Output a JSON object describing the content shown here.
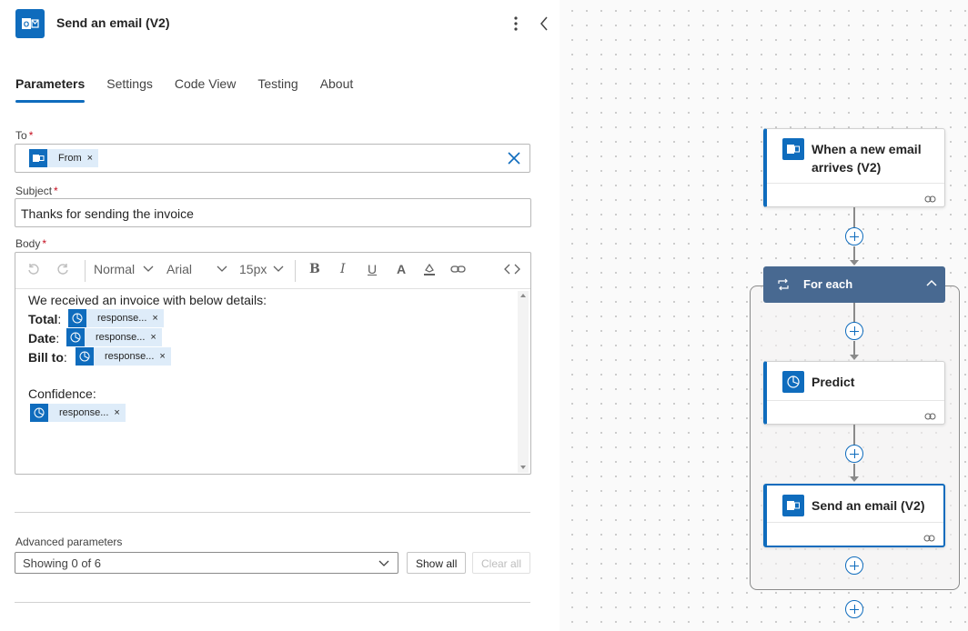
{
  "panel": {
    "title": "Send an email (V2)",
    "icon": "outlook-icon",
    "tabs": [
      {
        "label": "Parameters",
        "active": true
      },
      {
        "label": "Settings",
        "active": false
      },
      {
        "label": "Code View",
        "active": false
      },
      {
        "label": "Testing",
        "active": false
      },
      {
        "label": "About",
        "active": false
      }
    ],
    "to": {
      "label": "To",
      "required": "*",
      "token": "From"
    },
    "subject": {
      "label": "Subject",
      "required": "*",
      "value": "Thanks for sending the invoice"
    },
    "body": {
      "label": "Body",
      "required": "*",
      "toolbar": {
        "format": "Normal",
        "font": "Arial",
        "size": "15px"
      },
      "intro": "We received an invoice with below details:",
      "rows": [
        {
          "label": "Total",
          "token": "response..."
        },
        {
          "label": "Date",
          "token": "response..."
        },
        {
          "label": "Bill to",
          "token": "response..."
        }
      ],
      "confidence_label": "Confidence:",
      "confidence_token": "response..."
    },
    "advanced": {
      "label": "Advanced parameters",
      "select_value": "Showing 0 of 6",
      "show_all": "Show all",
      "clear_all": "Clear all"
    }
  },
  "canvas": {
    "trigger": {
      "title_line1": "When a new email",
      "title_line2": "arrives (V2)"
    },
    "foreach": {
      "title": "For each"
    },
    "predict": {
      "title": "Predict"
    },
    "send": {
      "title": "Send an email (V2)"
    }
  },
  "colors": {
    "accent": "#0f6cbd",
    "foreach": "#486991",
    "required": "#c50f1f",
    "token_bg": "#deecf9"
  }
}
